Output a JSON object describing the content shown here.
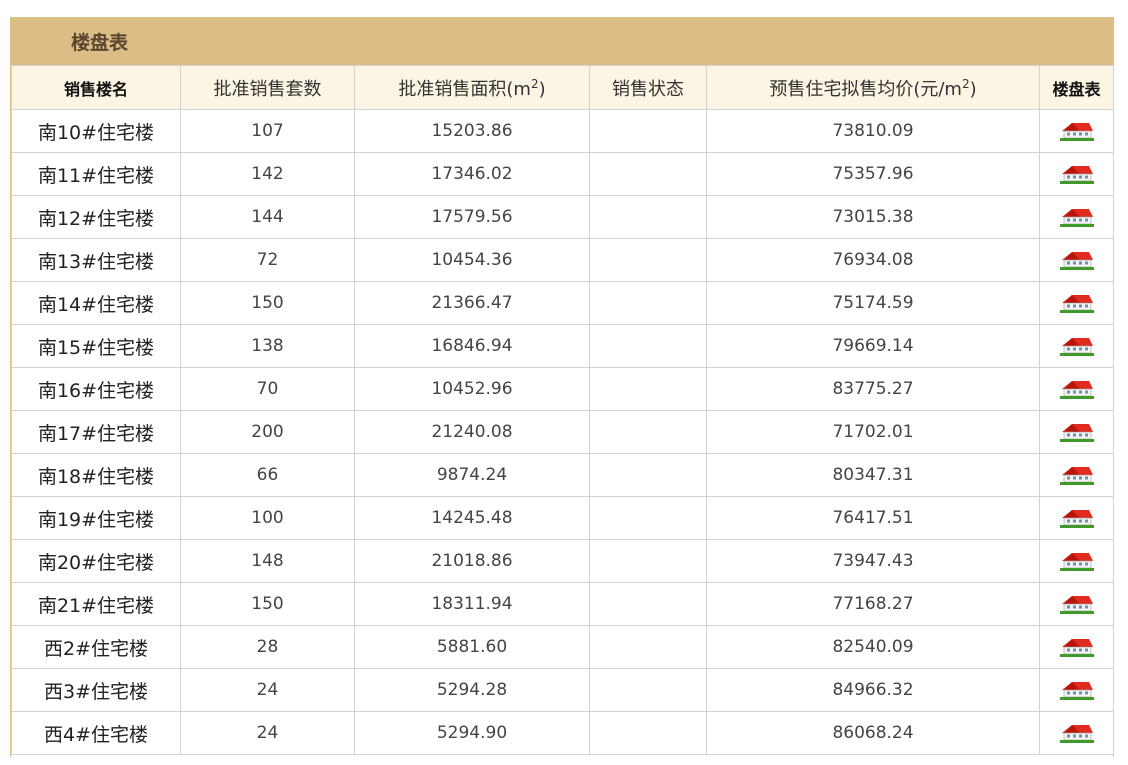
{
  "title": "楼盘表",
  "headers": {
    "name": "销售楼名",
    "units": "批准销售套数",
    "area_prefix": "批准销售面积(m",
    "area_sup": "2",
    "area_suffix": ")",
    "status": "销售状态",
    "price_prefix": "预售住宅拟售均价(元/m",
    "price_sup": "2",
    "price_suffix": ")",
    "chart": "楼盘表"
  },
  "icon": "house-icon",
  "colors": {
    "title_bar": "#dbbd85",
    "header_bg": "#fdf5e4",
    "border": "#d2d2d2",
    "roof": "#e12b1f",
    "grass": "#3e9a2a"
  },
  "rows": [
    {
      "name": "南10#住宅楼",
      "units": "107",
      "area": "15203.86",
      "status": "",
      "price": "73810.09"
    },
    {
      "name": "南11#住宅楼",
      "units": "142",
      "area": "17346.02",
      "status": "",
      "price": "75357.96"
    },
    {
      "name": "南12#住宅楼",
      "units": "144",
      "area": "17579.56",
      "status": "",
      "price": "73015.38"
    },
    {
      "name": "南13#住宅楼",
      "units": "72",
      "area": "10454.36",
      "status": "",
      "price": "76934.08"
    },
    {
      "name": "南14#住宅楼",
      "units": "150",
      "area": "21366.47",
      "status": "",
      "price": "75174.59"
    },
    {
      "name": "南15#住宅楼",
      "units": "138",
      "area": "16846.94",
      "status": "",
      "price": "79669.14"
    },
    {
      "name": "南16#住宅楼",
      "units": "70",
      "area": "10452.96",
      "status": "",
      "price": "83775.27"
    },
    {
      "name": "南17#住宅楼",
      "units": "200",
      "area": "21240.08",
      "status": "",
      "price": "71702.01"
    },
    {
      "name": "南18#住宅楼",
      "units": "66",
      "area": "9874.24",
      "status": "",
      "price": "80347.31"
    },
    {
      "name": "南19#住宅楼",
      "units": "100",
      "area": "14245.48",
      "status": "",
      "price": "76417.51"
    },
    {
      "name": "南20#住宅楼",
      "units": "148",
      "area": "21018.86",
      "status": "",
      "price": "73947.43"
    },
    {
      "name": "南21#住宅楼",
      "units": "150",
      "area": "18311.94",
      "status": "",
      "price": "77168.27"
    },
    {
      "name": "西2#住宅楼",
      "units": "28",
      "area": "5881.60",
      "status": "",
      "price": "82540.09"
    },
    {
      "name": "西3#住宅楼",
      "units": "24",
      "area": "5294.28",
      "status": "",
      "price": "84966.32"
    },
    {
      "name": "西4#住宅楼",
      "units": "24",
      "area": "5294.90",
      "status": "",
      "price": "86068.24"
    }
  ]
}
